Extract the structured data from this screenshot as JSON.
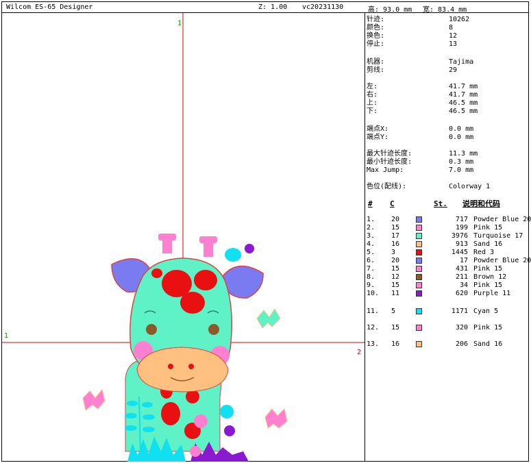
{
  "titlebar": {
    "app": "Wilcom ES-65 Designer",
    "zoom": "Z: 1.00",
    "version": "vc20231130",
    "height": "高: 93.0 mm",
    "width": "宽: 83.4 mm"
  },
  "canvas": {
    "marker_top": "1",
    "marker_left": "1",
    "marker_right": "2"
  },
  "stats": [
    {
      "label": "针迹:",
      "value": "10262"
    },
    {
      "label": "颜色:",
      "value": "8"
    },
    {
      "label": "换色:",
      "value": "12"
    },
    {
      "label": "停止:",
      "value": "13"
    },
    {
      "label": "机器:",
      "value": "Tajima"
    },
    {
      "label": "剪线:",
      "value": "29"
    },
    {
      "label": "左:",
      "value": "41.7 mm"
    },
    {
      "label": "右:",
      "value": "41.7 mm"
    },
    {
      "label": "上:",
      "value": "46.5 mm"
    },
    {
      "label": "下:",
      "value": "46.5 mm"
    },
    {
      "label": "端点X:",
      "value": "0.0 mm"
    },
    {
      "label": "端点Y:",
      "value": "0.0 mm"
    },
    {
      "label": "最大针迹长度:",
      "value": "11.3 mm"
    },
    {
      "label": "最小针迹长度:",
      "value": "0.3 mm"
    },
    {
      "label": "Max Jump:",
      "value": "7.0 mm"
    },
    {
      "label": "色位(配线):",
      "value": "Colorway 1"
    }
  ],
  "color_table": {
    "headers": {
      "num": "#",
      "code": "C",
      "stitches": "St.",
      "desc": "说明和代码"
    },
    "rows": [
      {
        "num": "1.",
        "code": "20",
        "color": "#7b7bf0",
        "stitches": "717",
        "name": "Powder Blue 20"
      },
      {
        "num": "2.",
        "code": "15",
        "color": "#ff7fd0",
        "stitches": "199",
        "name": "Pink 15"
      },
      {
        "num": "3.",
        "code": "17",
        "color": "#5ff2c6",
        "stitches": "3976",
        "name": "Turquoise 17"
      },
      {
        "num": "4.",
        "code": "16",
        "color": "#ffc080",
        "stitches": "913",
        "name": "Sand 16"
      },
      {
        "num": "5.",
        "code": "3",
        "color": "#e81010",
        "stitches": "1445",
        "name": "Red 3"
      },
      {
        "num": "6.",
        "code": "20",
        "color": "#7b7bf0",
        "stitches": "17",
        "name": "Powder Blue 20"
      },
      {
        "num": "7.",
        "code": "15",
        "color": "#ff7fd0",
        "stitches": "431",
        "name": "Pink 15"
      },
      {
        "num": "8.",
        "code": "12",
        "color": "#8b5a2b",
        "stitches": "211",
        "name": "Brown 12"
      },
      {
        "num": "9.",
        "code": "15",
        "color": "#ff7fd0",
        "stitches": "34",
        "name": "Pink 15"
      },
      {
        "num": "10.",
        "code": "11",
        "color": "#8a1ad0",
        "stitches": "620",
        "name": "Purple 11"
      },
      {
        "num": "11.",
        "code": "5",
        "color": "#10e0f0",
        "stitches": "1171",
        "name": "Cyan 5"
      },
      {
        "num": "12.",
        "code": "15",
        "color": "#ff7fd0",
        "stitches": "320",
        "name": "Pink 15"
      },
      {
        "num": "13.",
        "code": "16",
        "color": "#ffc080",
        "stitches": "206",
        "name": "Sand 16"
      }
    ]
  }
}
